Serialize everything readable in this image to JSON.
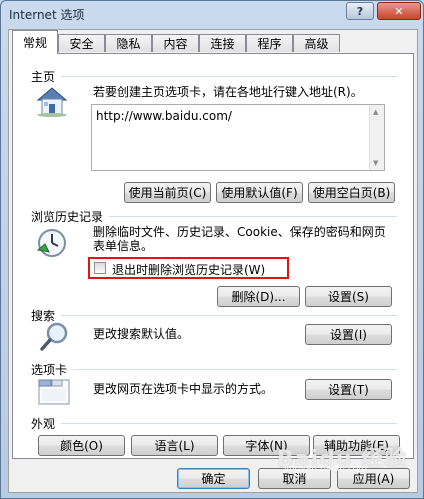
{
  "window": {
    "title": "Internet 选项",
    "help_glyph": "?",
    "close_glyph": "✕"
  },
  "tabs": [
    "常规",
    "安全",
    "隐私",
    "内容",
    "连接",
    "程序",
    "高级"
  ],
  "home": {
    "section": "主页",
    "instruction": "若要创建主页选项卡，请在各地址行键入地址(R)。",
    "url": "http://www.baidu.com/",
    "buttons": {
      "use_current": "使用当前页(C)",
      "use_default": "使用默认值(F)",
      "use_blank": "使用空白页(B)"
    }
  },
  "history": {
    "section": "浏览历史记录",
    "desc_line1": "删除临时文件、历史记录、Cookie、保存的密码和网页",
    "desc_line2": "表单信息。",
    "checkbox_label": "退出时删除浏览历史记录(W)",
    "checkbox_checked": false,
    "delete_button": "删除(D)...",
    "settings_button": "设置(S)"
  },
  "search": {
    "section": "搜索",
    "desc": "更改搜索默认值。",
    "settings_button": "设置(I)"
  },
  "tabs_section": {
    "section": "选项卡",
    "desc": "更改网页在选项卡中显示的方式。",
    "settings_button": "设置(T)"
  },
  "appearance": {
    "section": "外观",
    "buttons": {
      "colors": "颜色(O)",
      "languages": "语言(L)",
      "fonts": "字体(N)",
      "accessibility": "辅助功能(E)"
    }
  },
  "footer": {
    "ok": "确定",
    "cancel": "取消",
    "apply": "应用(A)"
  },
  "watermark": {
    "main": "Baidu 经验",
    "sub": "jingyan.baidu.com"
  }
}
